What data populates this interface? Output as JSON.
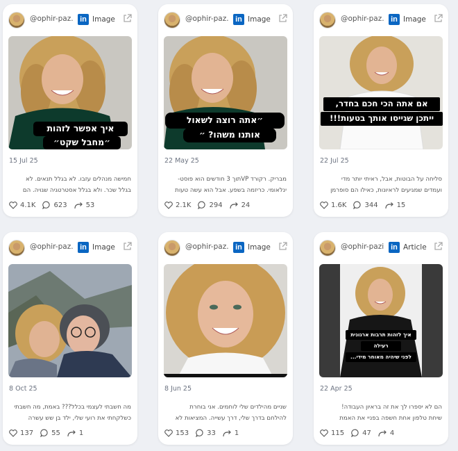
{
  "cards": [
    {
      "handle": "@ophir-paz...",
      "type": "Image",
      "overlay": [
        "איך אפשר לזהות",
        "״מחבל שקט״"
      ],
      "date": "15 Jul 25",
      "text": [
        "חמישה מנהלים עזבו. לא בגלל תנאים. לא",
        "בגלל שכר. ולא בגלל אסטרטגיה שגויה. הם"
      ],
      "likes": "4.1K",
      "comments": "623",
      "reposts": "53"
    },
    {
      "handle": "@ophir-paz...",
      "type": "Image",
      "overlay": [
        "״אתה רוצה לשאול",
        "אותנו משהו? ״"
      ],
      "date": "22 May 25",
      "text": [
        "מבריק. רקורד VPתוך 3 חודשים הוא פוסט-",
        "ינלאומי. כריזמה בשפע. אבל הוא עשה טעות"
      ],
      "likes": "2.1K",
      "comments": "294",
      "reposts": "24"
    },
    {
      "handle": "@ophir-paz...",
      "type": "Image",
      "overlay": [
        "אם אתה הכי חכם בחדר,",
        "ייתכן שגייסו אותך בטעות!!!"
      ],
      "date": "22 Jul 25",
      "text": [
        "סליחה על הבוטות, אבל, ראיתי יותר מדי",
        "ועמדים שמגיעים לראיונות, כאילו הם סופרמן"
      ],
      "likes": "1.6K",
      "comments": "344",
      "reposts": "15"
    },
    {
      "handle": "@ophir-paz...",
      "type": "Image",
      "overlay": [],
      "date": "8 Oct 25",
      "text": [
        "מה חשבתי לעצמי בכלל??? באמת, מה חשבתי",
        "כשלקחתי את רועי שלי, ילד בן שש עשרה"
      ],
      "likes": "137",
      "comments": "55",
      "reposts": "1"
    },
    {
      "handle": "@ophir-paz...",
      "type": "Image",
      "overlay": [],
      "date": "8 Jun 25",
      "text": [
        "שניים מהילדים שלי לוחמים. אני בוחרת",
        "להילחם בדרך שלי, דרך עשייה. המציאות לא"
      ],
      "likes": "153",
      "comments": "33",
      "reposts": "1"
    },
    {
      "handle": "@ophir-pazi...",
      "type": "Article",
      "overlay": [
        "איך לזהות תרבות ארגונית",
        "רעילה",
        "לפני שיהיה מאוחר מידי..."
      ],
      "date": "22 Apr 25",
      "text": [
        "הם לא יספרו לך את זה בראיון העבודה!",
        "שיחת טלפון אחת חשפה בפניי את האמת"
      ],
      "likes": "115",
      "comments": "47",
      "reposts": "4"
    }
  ],
  "icons": {
    "linkedin": "in",
    "external_link": "external-link-icon",
    "like": "heart-icon",
    "comment": "comment-icon",
    "repost": "repost-icon"
  },
  "colors": {
    "background": "#eef0f4",
    "linkedin_blue": "#0a66c2",
    "card": "#ffffff"
  }
}
